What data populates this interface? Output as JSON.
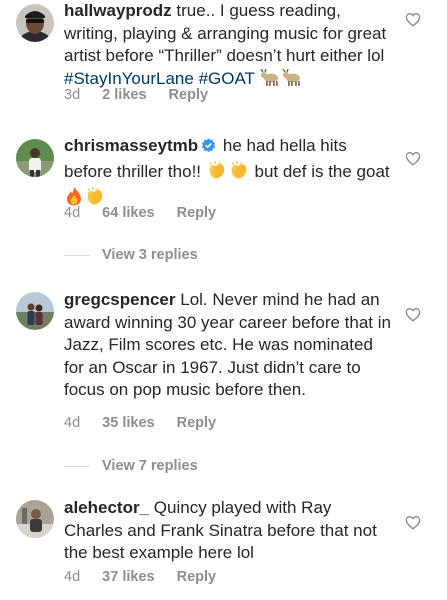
{
  "comments": [
    {
      "username": "hallwayprodz",
      "text": "true.. I guess reading, writing, playing & arranging music for great artist before “Thriller” doesn’t hurt either lol",
      "hashtags": [
        "#StayInYourLane",
        "#GOAT"
      ],
      "emojis": [
        "goat-emoji",
        "goat-emoji"
      ],
      "time": "3d",
      "likes": "2 likes",
      "reply": "Reply",
      "verified": false
    },
    {
      "username": "chrismasseytmb",
      "text_part1": "he had hella hits before thriller tho!!",
      "text_part2": "but def is the goat",
      "emojis": [
        "clapping-hands-emoji",
        "clapping-hands-emoji",
        "fire-emoji",
        "clapping-hands-emoji"
      ],
      "time": "4d",
      "likes": "64 likes",
      "reply": "Reply",
      "verified": true,
      "view_replies": "View 3 replies"
    },
    {
      "username": "gregcspencer",
      "text": "Lol. Never mind he had an award winning 30 year career before that in Jazz, Film scores etc. He was nominated for an Oscar in 1967. Just didn’t care to focus on pop music before then.",
      "time": "4d",
      "likes": "35 likes",
      "reply": "Reply",
      "verified": false,
      "view_replies": "View 7 replies"
    },
    {
      "username": "alehector_",
      "text": "Quincy played with Ray Charles and Frank Sinatra before that not the best example here lol",
      "time": "4d",
      "likes": "37 likes",
      "reply": "Reply",
      "verified": false
    }
  ],
  "colors": {
    "text": "#262626",
    "secondary": "#8e8e8e",
    "hashtag": "#00376b",
    "verified": "#3897f0"
  }
}
